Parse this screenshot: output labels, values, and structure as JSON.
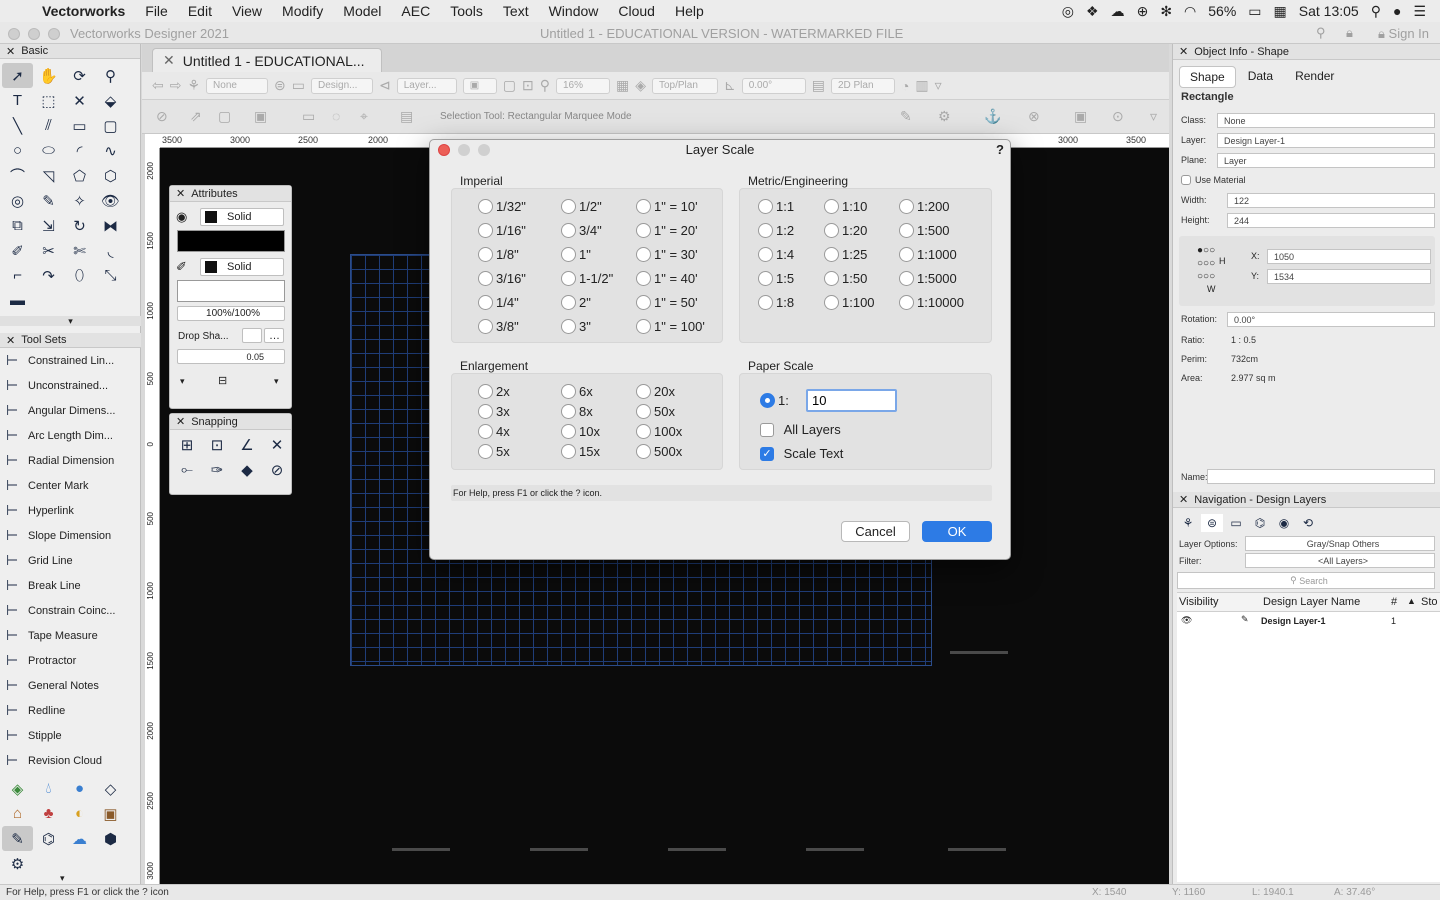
{
  "menubar": {
    "app": "Vectorworks",
    "items": [
      "File",
      "Edit",
      "View",
      "Modify",
      "Model",
      "AEC",
      "Tools",
      "Text",
      "Window",
      "Cloud",
      "Help"
    ],
    "battery": "56%",
    "clock": "Sat 13:05"
  },
  "window": {
    "app_title": "Vectorworks Designer 2021",
    "doc_title": "Untitled 1 - EDUCATIONAL VERSION - WATERMARKED FILE",
    "sign_in": "Sign In"
  },
  "doc_tab": {
    "label": "Untitled 1 - EDUCATIONAL..."
  },
  "view_bar": {
    "class": "None",
    "design": "Design...",
    "layer": "Layer...",
    "zoom": "16%",
    "view": "Top/Plan",
    "angle": "0.00°",
    "render": "2D Plan"
  },
  "mode_bar": {
    "status": "Selection Tool: Rectangular Marquee Mode"
  },
  "ruler": {
    "h": [
      "3500",
      "3000",
      "2500",
      "2000",
      "3000",
      "3500"
    ],
    "v": [
      "2000",
      "1500",
      "1000",
      "500",
      "0",
      "500",
      "1000",
      "1500",
      "2000",
      "2500",
      "3000"
    ]
  },
  "left_palette": {
    "basic_title": "Basic",
    "toolsets_title": "Tool Sets",
    "toolsets": [
      {
        "label": "Constrained Lin...",
        "icon": "constrained-linear-icon"
      },
      {
        "label": "Unconstrained...",
        "icon": "unconstrained-icon"
      },
      {
        "label": "Angular Dimens...",
        "icon": "angular-dim-icon"
      },
      {
        "label": "Arc Length Dim...",
        "icon": "arc-length-icon"
      },
      {
        "label": "Radial Dimension",
        "icon": "radial-dim-icon"
      },
      {
        "label": "Center Mark",
        "icon": "center-mark-icon"
      },
      {
        "label": "Hyperlink",
        "icon": "hyperlink-icon"
      },
      {
        "label": "Slope Dimension",
        "icon": "slope-dim-icon"
      },
      {
        "label": "Grid Line",
        "icon": "grid-line-icon"
      },
      {
        "label": "Break Line",
        "icon": "break-line-icon"
      },
      {
        "label": "Constrain Coinc...",
        "icon": "constrain-coincident-icon"
      },
      {
        "label": "Tape Measure",
        "icon": "tape-measure-icon"
      },
      {
        "label": "Protractor",
        "icon": "protractor-icon"
      },
      {
        "label": "General Notes",
        "icon": "general-notes-icon"
      },
      {
        "label": "Redline",
        "icon": "redline-icon"
      },
      {
        "label": "Stipple",
        "icon": "stipple-icon"
      },
      {
        "label": "Revision Cloud",
        "icon": "revision-cloud-icon"
      }
    ]
  },
  "attributes": {
    "title": "Attributes",
    "fill": "Solid",
    "pen": "Solid",
    "opacity": "100%/100%",
    "drop_shadow": "Drop Sha...",
    "line_weight": "0.05"
  },
  "snapping": {
    "title": "Snapping"
  },
  "dialog": {
    "title": "Layer Scale",
    "imperial": {
      "label": "Imperial",
      "col1": [
        "1/32\"",
        "1/16\"",
        "1/8\"",
        "3/16\"",
        "1/4\"",
        "3/8\""
      ],
      "col2": [
        "1/2\"",
        "3/4\"",
        "1\"",
        "1-1/2\"",
        "2\"",
        "3\""
      ],
      "col3": [
        "1\" = 10'",
        "1\" = 20'",
        "1\" = 30'",
        "1\" = 40'",
        "1\" = 50'",
        "1\" = 100'"
      ]
    },
    "metric": {
      "label": "Metric/Engineering",
      "col1": [
        "1:1",
        "1:2",
        "1:4",
        "1:5",
        "1:8"
      ],
      "col2": [
        "1:10",
        "1:20",
        "1:25",
        "1:50",
        "1:100"
      ],
      "col3": [
        "1:200",
        "1:500",
        "1:1000",
        "1:5000",
        "1:10000"
      ]
    },
    "enlargement": {
      "label": "Enlargement",
      "col1": [
        "2x",
        "3x",
        "4x",
        "5x"
      ],
      "col2": [
        "6x",
        "8x",
        "10x",
        "15x"
      ],
      "col3": [
        "20x",
        "50x",
        "100x",
        "500x"
      ]
    },
    "paper_scale": {
      "label": "Paper Scale",
      "prefix": "1:",
      "value": "10",
      "all_layers": "All Layers",
      "scale_text": "Scale Text",
      "all_layers_checked": false,
      "scale_text_checked": true
    },
    "help": "For Help, press F1 or click the ? icon.",
    "cancel": "Cancel",
    "ok": "OK"
  },
  "object_info": {
    "title": "Object Info - Shape",
    "tabs": [
      "Shape",
      "Data",
      "Render"
    ],
    "object_type": "Rectangle",
    "class_label": "Class:",
    "class": "None",
    "layer_label": "Layer:",
    "layer": "Design Layer-1",
    "plane_label": "Plane:",
    "plane": "Layer",
    "use_material": "Use Material",
    "width_label": "Width:",
    "width": "122",
    "height_label": "Height:",
    "height": "244",
    "x_label": "X:",
    "x": "1050",
    "y_label": "Y:",
    "y": "1534",
    "rotation_label": "Rotation:",
    "rotation": "0.00°",
    "ratio_label": "Ratio:",
    "ratio": "1 : 0.5",
    "perim_label": "Perim:",
    "perim": "732cm",
    "area_label": "Area:",
    "area": "2.977 sq m",
    "name_label": "Name:",
    "h_letter": "H",
    "w_letter": "W"
  },
  "navigation": {
    "title": "Navigation - Design Layers",
    "layer_options_label": "Layer Options:",
    "layer_options": "Gray/Snap Others",
    "filter_label": "Filter:",
    "filter": "<All Layers>",
    "search_placeholder": "Search",
    "columns": [
      "Visibility",
      "Design Layer Name",
      "#",
      "Sto"
    ],
    "rows": [
      {
        "name": "Design Layer-1",
        "num": "1"
      }
    ]
  },
  "statusbar": {
    "help": "For Help, press F1 or click the ? icon",
    "x": "X: 1540",
    "y": "Y: 1160",
    "l": "L: 1940.1",
    "a": "A: 37.46°"
  },
  "colors": {
    "accent": "#2d7be5",
    "canvas": "#0b0b0b",
    "grid": "#1f3d78"
  }
}
